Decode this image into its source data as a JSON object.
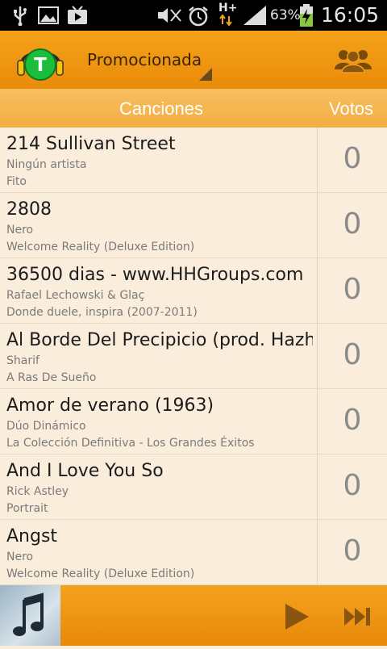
{
  "status_bar": {
    "battery_percent": "63%",
    "time": "16:05",
    "network_type": "H+"
  },
  "app_bar": {
    "logo_letter": "T",
    "mode_selected": "Promocionada",
    "icons": [
      "app-logo",
      "group-users-icon"
    ]
  },
  "list_header": {
    "songs_label": "Canciones",
    "votes_label": "Votos"
  },
  "songs": [
    {
      "title": "214 Sullivan Street",
      "artist": "Ningún artista",
      "album": "Fito",
      "votes": "0"
    },
    {
      "title": "2808",
      "artist": "Nero",
      "album": "Welcome Reality (Deluxe Edition)",
      "votes": "0"
    },
    {
      "title": "36500 dias - www.HHGroups.com",
      "artist": "Rafael Lechowski & Glaç",
      "album": "Donde duele, inspira (2007-2011)",
      "votes": "0"
    },
    {
      "title": "Al Borde Del Precipicio (prod. Hazhe)",
      "artist": "Sharif",
      "album": "A Ras De Sueño",
      "votes": "0"
    },
    {
      "title": "Amor de verano (1963)",
      "artist": "Dúo Dinámico",
      "album": "La Colección Definitiva - Los Grandes Éxitos",
      "votes": "0"
    },
    {
      "title": "And I Love You So",
      "artist": "Rick Astley",
      "album": "Portrait",
      "votes": "0"
    },
    {
      "title": "Angst",
      "artist": "Nero",
      "album": "Welcome Reality (Deluxe Edition)",
      "votes": "0"
    }
  ],
  "player": {
    "icons": [
      "music-note-icon",
      "play-icon",
      "skip-next-icon"
    ]
  },
  "colors": {
    "accent": "#f39a14",
    "header_bg": "#f5b24d",
    "list_bg": "#fbeddb",
    "logo_green": "#1bbd3a"
  }
}
